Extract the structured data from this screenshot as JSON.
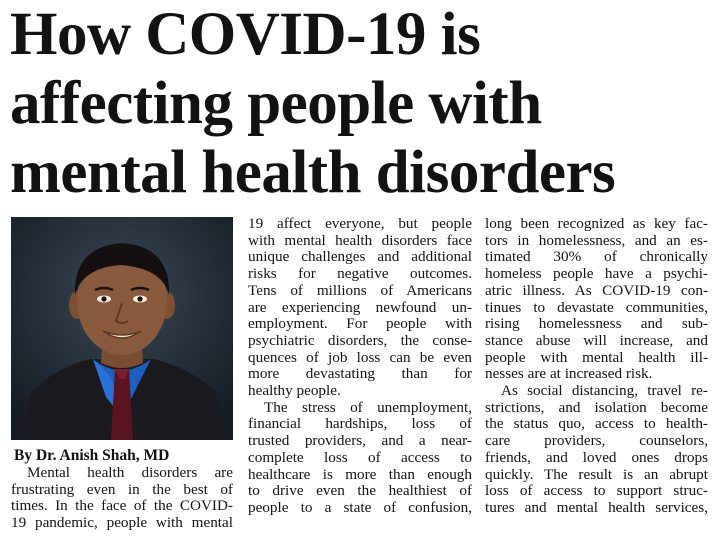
{
  "headline": [
    "How COVID-19 is",
    "affecting people with",
    "mental health disorders"
  ],
  "byline": "By Dr. Anish Shah, MD",
  "columns": {
    "col1": [
      {
        "t": "Mental health disorders are",
        "ind": true
      },
      {
        "t": "frustrating even in the best of"
      },
      {
        "t": "times. In the face of the COVID-"
      },
      {
        "t": "19 pandemic, people with mental"
      }
    ],
    "col2": [
      {
        "t": "19 affect everyone, but people"
      },
      {
        "t": "with mental health disorders face"
      },
      {
        "t": "unique challenges and additional"
      },
      {
        "t": "risks for negative outcomes."
      },
      {
        "t": "Tens of millions of Americans"
      },
      {
        "t": "are experiencing newfound un-"
      },
      {
        "t": "employment. For people with"
      },
      {
        "t": "psychiatric disorders, the conse-"
      },
      {
        "t": "quences of job loss can be even"
      },
      {
        "t": "more devastating than for"
      },
      {
        "t": "healthy people.",
        "last": true
      },
      {
        "t": "The stress of unemployment,",
        "ind": true
      },
      {
        "t": "financial hardships, loss of"
      },
      {
        "t": "trusted providers, and a near-"
      },
      {
        "t": "complete loss of access to"
      },
      {
        "t": "healthcare is more than enough"
      },
      {
        "t": "to drive even the healthiest of"
      },
      {
        "t": "people to a state of confusion,"
      }
    ],
    "col3": [
      {
        "t": "long been recognized as key fac-"
      },
      {
        "t": "tors in homelessness, and an es-"
      },
      {
        "t": "timated 30% of chronically"
      },
      {
        "t": "homeless people have a psychi-"
      },
      {
        "t": "atric illness. As COVID-19 con-"
      },
      {
        "t": "tinues to devastate communities,"
      },
      {
        "t": "rising homelessness and sub-"
      },
      {
        "t": "stance abuse will increase, and"
      },
      {
        "t": "people with mental health ill-"
      },
      {
        "t": "nesses are at increased risk.",
        "last": true
      },
      {
        "t": "As social distancing, travel re-",
        "ind": true
      },
      {
        "t": "strictions, and isolation become"
      },
      {
        "t": "the status quo, access to health-"
      },
      {
        "t": "care providers, counselors,"
      },
      {
        "t": "friends, and loved ones drops"
      },
      {
        "t": "quickly. The result is an abrupt"
      },
      {
        "t": "loss of access to support struc-"
      },
      {
        "t": "tures and mental health services,"
      }
    ]
  },
  "colors": {
    "photo_bg": "#1f2a36",
    "shirt": "#1d5fbf",
    "tie": "#5a1420",
    "jacket": "#1a1a1e",
    "skin": "#8a5a3c"
  }
}
